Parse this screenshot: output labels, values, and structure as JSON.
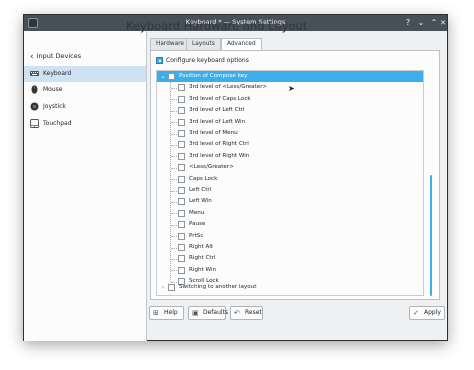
{
  "window": {
    "title": "Keyboard * — System Settings",
    "controls": {
      "help": "?",
      "minimize": "⌄",
      "maximize": "⌃",
      "close": "✕"
    }
  },
  "sidebar": {
    "back_label": "Input Devices",
    "items": [
      {
        "label": "Keyboard",
        "icon": "keyboard-icon",
        "active": true
      },
      {
        "label": "Mouse",
        "icon": "mouse-icon",
        "active": false
      },
      {
        "label": "Joystick",
        "icon": "joystick-icon",
        "active": false
      },
      {
        "label": "Touchpad",
        "icon": "touchpad-icon",
        "active": false
      }
    ]
  },
  "main": {
    "title": "Keyboard Hardware and Layout",
    "tabs": [
      {
        "label": "Hardware",
        "active": false
      },
      {
        "label": "Layouts",
        "active": false
      },
      {
        "label": "Advanced",
        "active": true
      }
    ],
    "configure_label": "Configure keyboard options",
    "configure_checked": true,
    "tree": {
      "group_label": "Position of Compose key",
      "options": [
        "3rd level of <Less/Greater>",
        "3rd level of Caps Lock",
        "3rd level of Left Ctrl",
        "3rd level of Left Win",
        "3rd level of Menu",
        "3rd level of Right Ctrl",
        "3rd level of Right Win",
        "<Less/Greater>",
        "Caps Lock",
        "Left Ctrl",
        "Left Win",
        "Menu",
        "Pause",
        "PrtSc",
        "Right Alt",
        "Right Ctrl",
        "Right Win",
        "Scroll Lock"
      ],
      "next_group_label": "Switching to another layout"
    }
  },
  "buttons": {
    "help": "Help",
    "defaults": "Defaults",
    "reset": "Reset",
    "apply": "Apply"
  },
  "colors": {
    "accent": "#3daee9",
    "titlebar": "#475057",
    "selection": "#cfe2f3"
  }
}
